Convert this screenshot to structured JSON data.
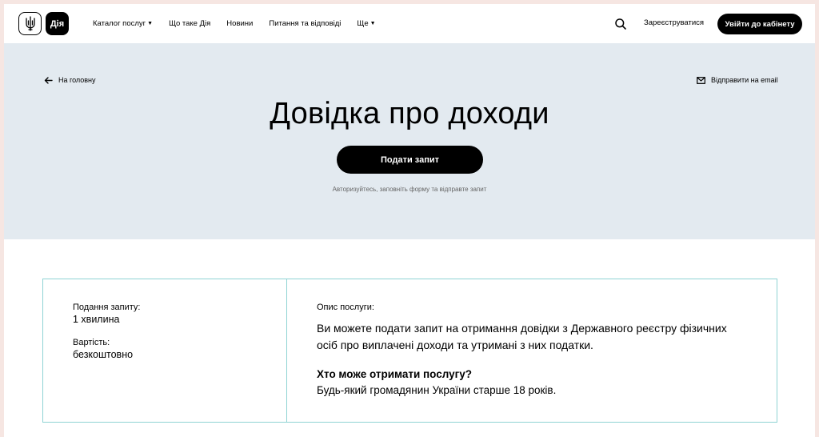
{
  "header": {
    "logo_text": "Дія",
    "nav": [
      {
        "label": "Каталог послуг",
        "has_caret": true
      },
      {
        "label": "Що таке Дія",
        "has_caret": false
      },
      {
        "label": "Новини",
        "has_caret": false
      },
      {
        "label": "Питання та відповіді",
        "has_caret": false
      },
      {
        "label": "Ще",
        "has_caret": true
      }
    ],
    "register_label": "Зареєструватися",
    "login_label": "Увійти до кабінету"
  },
  "hero": {
    "back_label": "На головну",
    "email_label": "Відправити на email",
    "title": "Довідка про доходи",
    "submit_label": "Подати запит",
    "hint": "Авторизуйтесь, заповніть форму та відправте запит"
  },
  "info": {
    "submission_label": "Подання запиту:",
    "submission_value": "1 хвилина",
    "cost_label": "Вартість:",
    "cost_value": "безкоштовно",
    "description_label": "Опис послуги:",
    "description_text": "Ви можете подати запит на отримання довідки з Державного реєстру фізичних осіб про виплачені доходи та утримані з них податки.",
    "who_title": "Хто може отримати послугу?",
    "who_text": "Будь-який громадянин України старше 18 років."
  },
  "colors": {
    "hero_bg": "#e3eaf0",
    "border_accent": "#8fd3d4",
    "button_bg": "#000000"
  }
}
